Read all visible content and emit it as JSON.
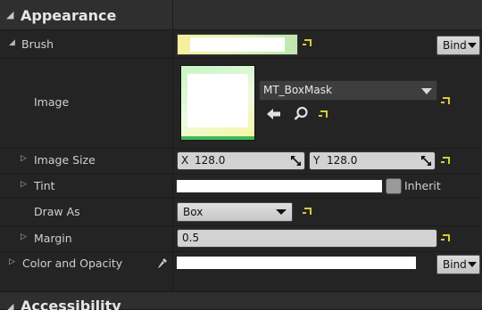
{
  "sections": {
    "appearance": {
      "title": "Appearance"
    },
    "accessibility": {
      "title": "Accessibility"
    }
  },
  "properties": {
    "brush": {
      "label": "Brush",
      "bind_label": "Bind"
    },
    "image": {
      "label": "Image",
      "asset_name": "MT_BoxMask"
    },
    "image_size": {
      "label": "Image Size",
      "x_label": "X",
      "x_value": "128.0",
      "y_label": "Y",
      "y_value": "128.0"
    },
    "tint": {
      "label": "Tint",
      "inherit_label": "Inherit"
    },
    "draw_as": {
      "label": "Draw As",
      "value": "Box"
    },
    "margin": {
      "label": "Margin",
      "value": "0.5"
    },
    "color_and_opacity": {
      "label": "Color and Opacity",
      "bind_label": "Bind"
    }
  },
  "icons": {
    "reset": "reset-to-default-icon",
    "browse": "use-selected-asset-icon",
    "find": "find-in-browser-icon",
    "pin": "pipette-icon"
  },
  "colors": {
    "panel_bg": "#242424",
    "header_bg": "#2f2f2f",
    "reset_arrow": "#d6cc38"
  }
}
